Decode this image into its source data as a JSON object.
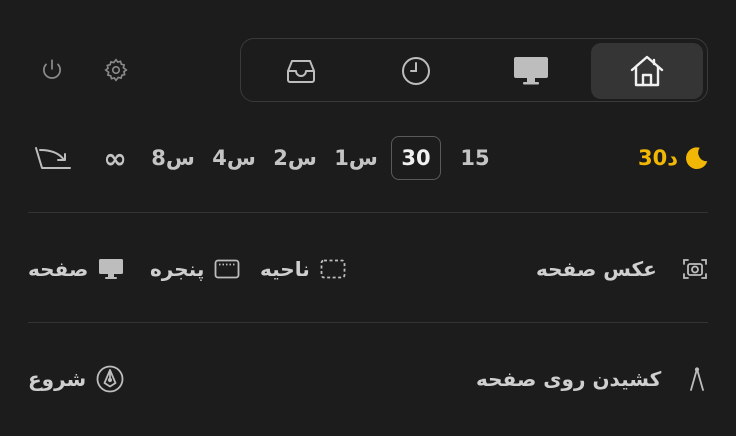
{
  "top_icons": {
    "power": "power-icon",
    "settings": "gear-icon"
  },
  "modes": [
    {
      "name": "inbox-tray-icon"
    },
    {
      "name": "clock-icon"
    },
    {
      "name": "monitor-icon"
    },
    {
      "name": "home-icon",
      "active": true
    }
  ],
  "timer": {
    "moon_label": "30د",
    "options": [
      "15",
      "30",
      "1س",
      "2س",
      "4س",
      "8س",
      "∞"
    ],
    "selected": "30"
  },
  "capture": {
    "screenshot_label": "عکس صفحه",
    "region_label": "ناحیه",
    "window_label": "پنجره",
    "screen_label": "صفحه"
  },
  "draw": {
    "draw_label": "کشیدن روی صفحه",
    "start_label": "شروع"
  },
  "colors": {
    "accent": "#f2b705",
    "background": "#1c1c1c"
  }
}
